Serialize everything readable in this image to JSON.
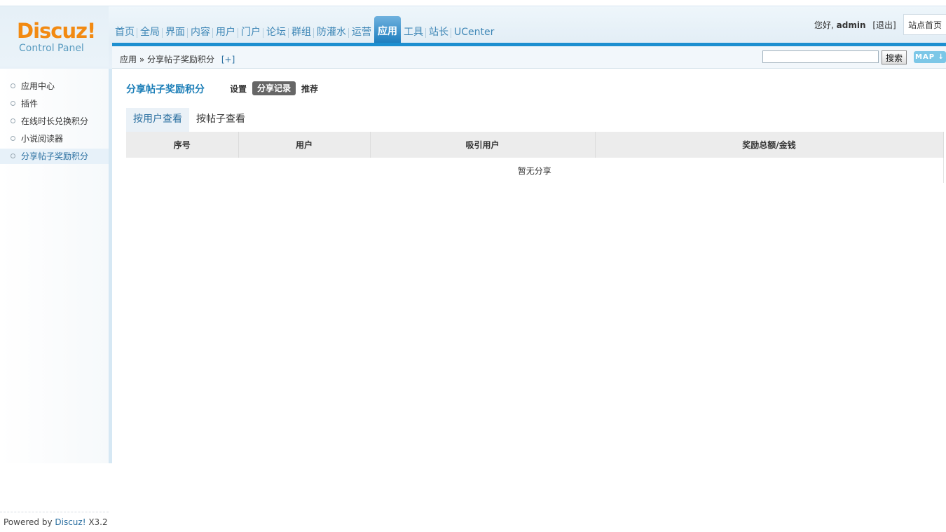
{
  "logo": {
    "brand": "Discuz!",
    "subtitle": "Control Panel"
  },
  "nav": {
    "items": [
      "首页",
      "全局",
      "界面",
      "内容",
      "用户",
      "门户",
      "论坛",
      "群组",
      "防灌水",
      "运营",
      "应用",
      "工具",
      "站长",
      "UCenter"
    ],
    "active": "应用"
  },
  "user": {
    "greeting": "您好,",
    "name": "admin",
    "logout": "[退出]"
  },
  "site_home": "站点首页",
  "breadcrumb": {
    "root": "应用",
    "separator": "»",
    "current": "分享帖子奖励积分",
    "add": "[+]"
  },
  "search": {
    "value": "",
    "button": "搜索",
    "map": "MAP ↓"
  },
  "sidebar": {
    "items": [
      "应用中心",
      "插件",
      "在线时长兑换积分",
      "小说阅读器",
      "分享帖子奖励积分"
    ],
    "active_index": 4,
    "footer": {
      "prefix": "Powered by ",
      "brand": "Discuz!",
      "version": " X3.2"
    }
  },
  "main": {
    "title": "分享帖子奖励积分",
    "tabs": [
      "设置",
      "分享记录",
      "推荐"
    ],
    "active_tab": "分享记录",
    "view_tabs": [
      "按用户查看",
      "按帖子查看"
    ],
    "active_view": "按用户查看",
    "table": {
      "columns": [
        "序号",
        "用户",
        "吸引用户",
        "奖励总额/金钱"
      ],
      "empty": "暂无分享"
    }
  },
  "colors": {
    "accent": "#1d8fd0",
    "logo": "#f28a12",
    "link": "#2a6fa0"
  }
}
